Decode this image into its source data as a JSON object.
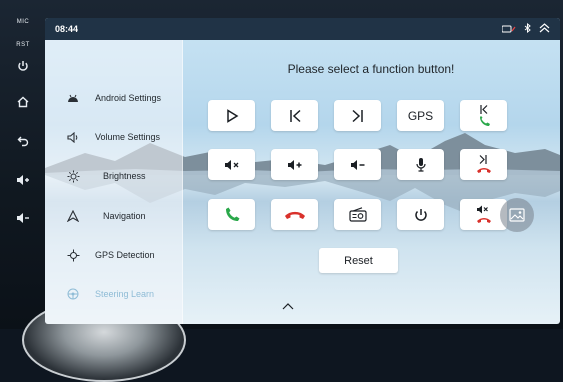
{
  "hardware": {
    "mic_label": "MIC",
    "rst_label": "RST"
  },
  "status_bar": {
    "time": "08:44",
    "icons": [
      "radio-signal-icon",
      "bluetooth-icon",
      "chevron-up-icon"
    ]
  },
  "sidebar": {
    "items": [
      {
        "label": "Android Settings",
        "icon": "android-icon"
      },
      {
        "label": "Volume Settings",
        "icon": "speaker-icon"
      },
      {
        "label": "Brightness",
        "icon": "sun-icon"
      },
      {
        "label": "Navigation",
        "icon": "navigation-arrow-icon"
      },
      {
        "label": "GPS Detection",
        "icon": "crosshair-icon"
      },
      {
        "label": "Steering Learn",
        "icon": "steering-wheel-icon",
        "state": "dimmed"
      }
    ]
  },
  "main": {
    "title": "Please select a function button!",
    "buttons": [
      {
        "icon": "play-icon"
      },
      {
        "icon": "previous-track-icon"
      },
      {
        "icon": "next-track-icon"
      },
      {
        "text": "GPS"
      },
      {
        "icon": "previous-call-icon"
      },
      {
        "icon": "mute-icon"
      },
      {
        "icon": "volume-up-icon"
      },
      {
        "icon": "volume-down-icon"
      },
      {
        "icon": "microphone-icon"
      },
      {
        "icon": "next-hangup-icon"
      },
      {
        "icon": "answer-call-icon"
      },
      {
        "icon": "hang-up-icon"
      },
      {
        "icon": "radio-icon"
      },
      {
        "icon": "power-icon"
      },
      {
        "icon": "mute-hangup-icon"
      }
    ],
    "reset_label": "Reset"
  },
  "colors": {
    "status_bar": "#203346",
    "accent_green": "#2aa84a",
    "accent_red": "#d9312b"
  }
}
